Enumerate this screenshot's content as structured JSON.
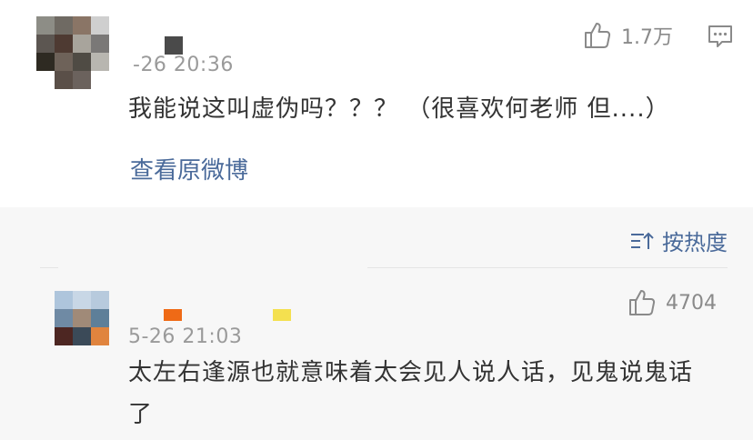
{
  "post": {
    "time": "-26 20:36",
    "text": "我能说这叫虚伪吗？？？ （很喜欢何老师 但....）",
    "like_count": "1.7万",
    "view_original": "查看原微博",
    "like_icon": "thumbs-up-icon",
    "comment_icon": "comment-icon"
  },
  "sort": {
    "label": "按热度",
    "icon": "sort-icon"
  },
  "reply": {
    "time": "5-26 21:03",
    "text": "太左右逢源也就意味着太会见人说人话，见鬼说鬼话了",
    "like_count": "4704",
    "like_icon": "thumbs-up-icon"
  },
  "colors": {
    "link": "#4a6a9a",
    "meta": "#9a9a9a",
    "text": "#333333",
    "section_bg": "#f7f7f7"
  }
}
